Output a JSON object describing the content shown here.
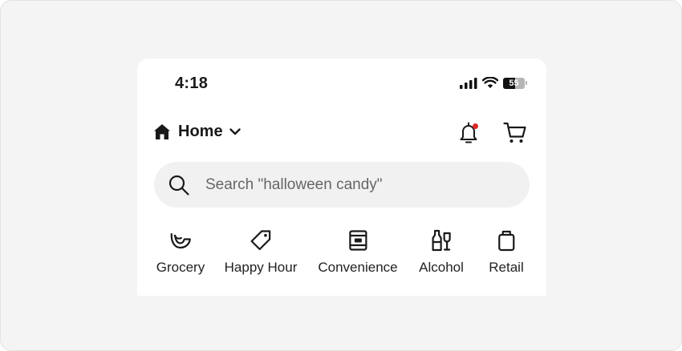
{
  "status_bar": {
    "time": "4:18",
    "battery_level": "55",
    "icons": [
      "cellular-signal-icon",
      "wifi-icon",
      "battery-icon"
    ]
  },
  "header": {
    "location_label": "Home",
    "icons": [
      "home-icon",
      "chevron-down-icon",
      "notification-bell-icon",
      "cart-icon"
    ],
    "notification_dot_color": "#e02626"
  },
  "search": {
    "placeholder": "Search \"halloween candy\""
  },
  "categories": [
    {
      "label": "Grocery",
      "icon": "grocery-icon"
    },
    {
      "label": "Happy Hour",
      "icon": "price-tag-icon"
    },
    {
      "label": "Convenience",
      "icon": "convenience-store-icon"
    },
    {
      "label": "Alcohol",
      "icon": "alcohol-bottles-icon"
    },
    {
      "label": "Retail",
      "icon": "shopping-bag-icon"
    }
  ],
  "colors": {
    "background": "#f4f4f4",
    "card": "#ffffff",
    "search_background": "#f1f1f1",
    "text": "#191919",
    "accent": "#e02626"
  }
}
